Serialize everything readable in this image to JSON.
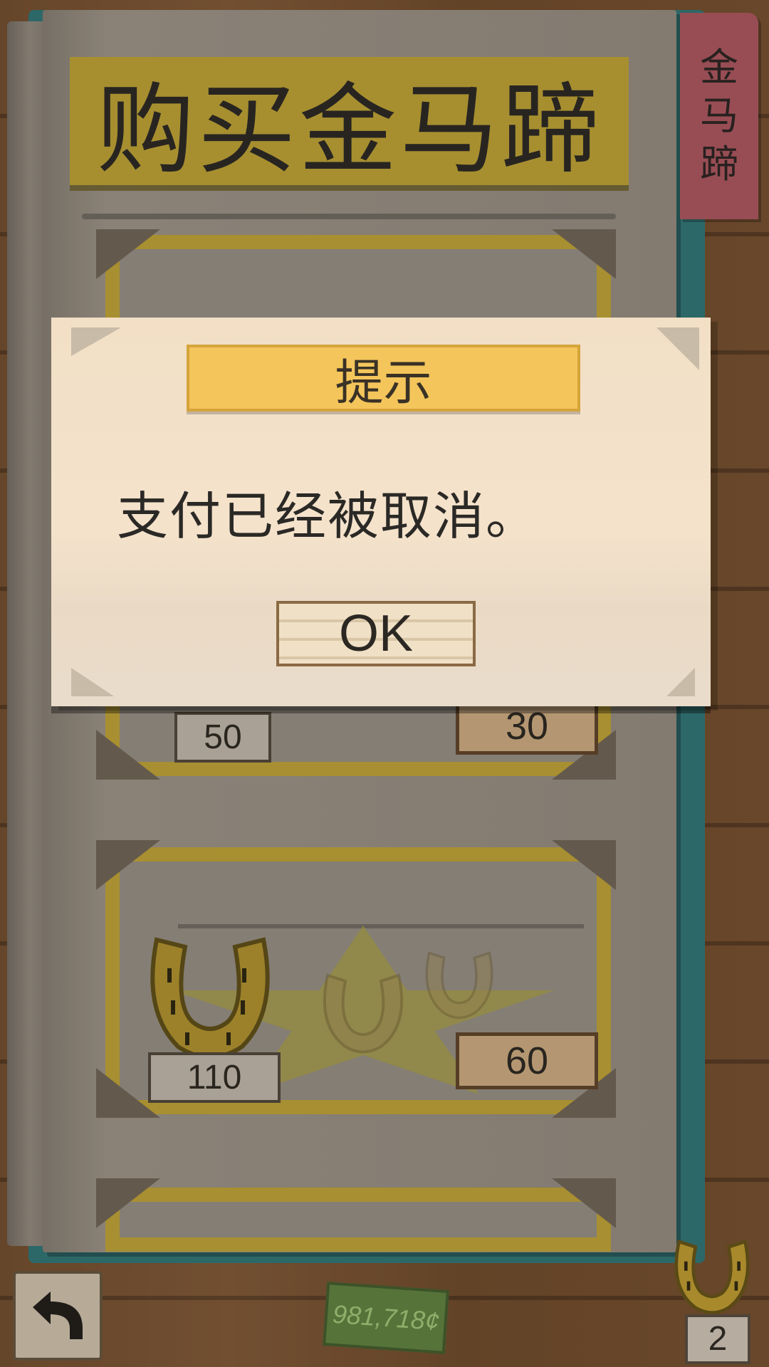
{
  "header": {
    "title": "购买金马蹄",
    "side_tab": [
      "金",
      "马",
      "蹄"
    ]
  },
  "items": [
    {
      "amount": "50",
      "price": "30"
    },
    {
      "amount": "110",
      "price": "60"
    }
  ],
  "dialog": {
    "title": "提示",
    "message": "支付已经被取消。",
    "ok_label": "OK"
  },
  "footer": {
    "coins": "981,718¢",
    "horseshoe_count": "2"
  },
  "icons": {
    "back": "back-arrow-icon",
    "horseshoe": "horseshoe-icon"
  },
  "colors": {
    "gold_banner": "#b39a32",
    "dialog_title": "#f4c55b",
    "dialog_bg": "#f2dfc6",
    "side_tab": "#a3525a",
    "money": "#56733a"
  }
}
